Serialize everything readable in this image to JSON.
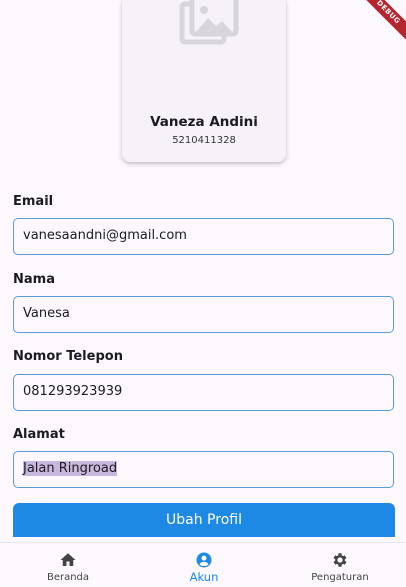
{
  "profile": {
    "name": "Vaneza Andini",
    "nim": "5210411328"
  },
  "debug_banner": "DEBUG",
  "form": {
    "email_label": "Email",
    "email_value": "vanesaandni@gmail.com",
    "nama_label": "Nama",
    "nama_value": "Vanesa",
    "telepon_label": "Nomor Telepon",
    "telepon_value": "081293923939",
    "alamat_label": "Alamat",
    "alamat_value": "Jalan Ringroad",
    "submit_label": "Ubah Profil"
  },
  "nav": {
    "items": [
      {
        "label": "Beranda",
        "icon": "home-icon"
      },
      {
        "label": "Akun",
        "icon": "account-circle-icon",
        "active": true
      },
      {
        "label": "Pengaturan",
        "icon": "gear-icon"
      }
    ]
  },
  "colors": {
    "accent": "#1e88e5",
    "field_border": "#5a9bd6",
    "background": "#fdf7fe",
    "debug": "#b5262e"
  }
}
